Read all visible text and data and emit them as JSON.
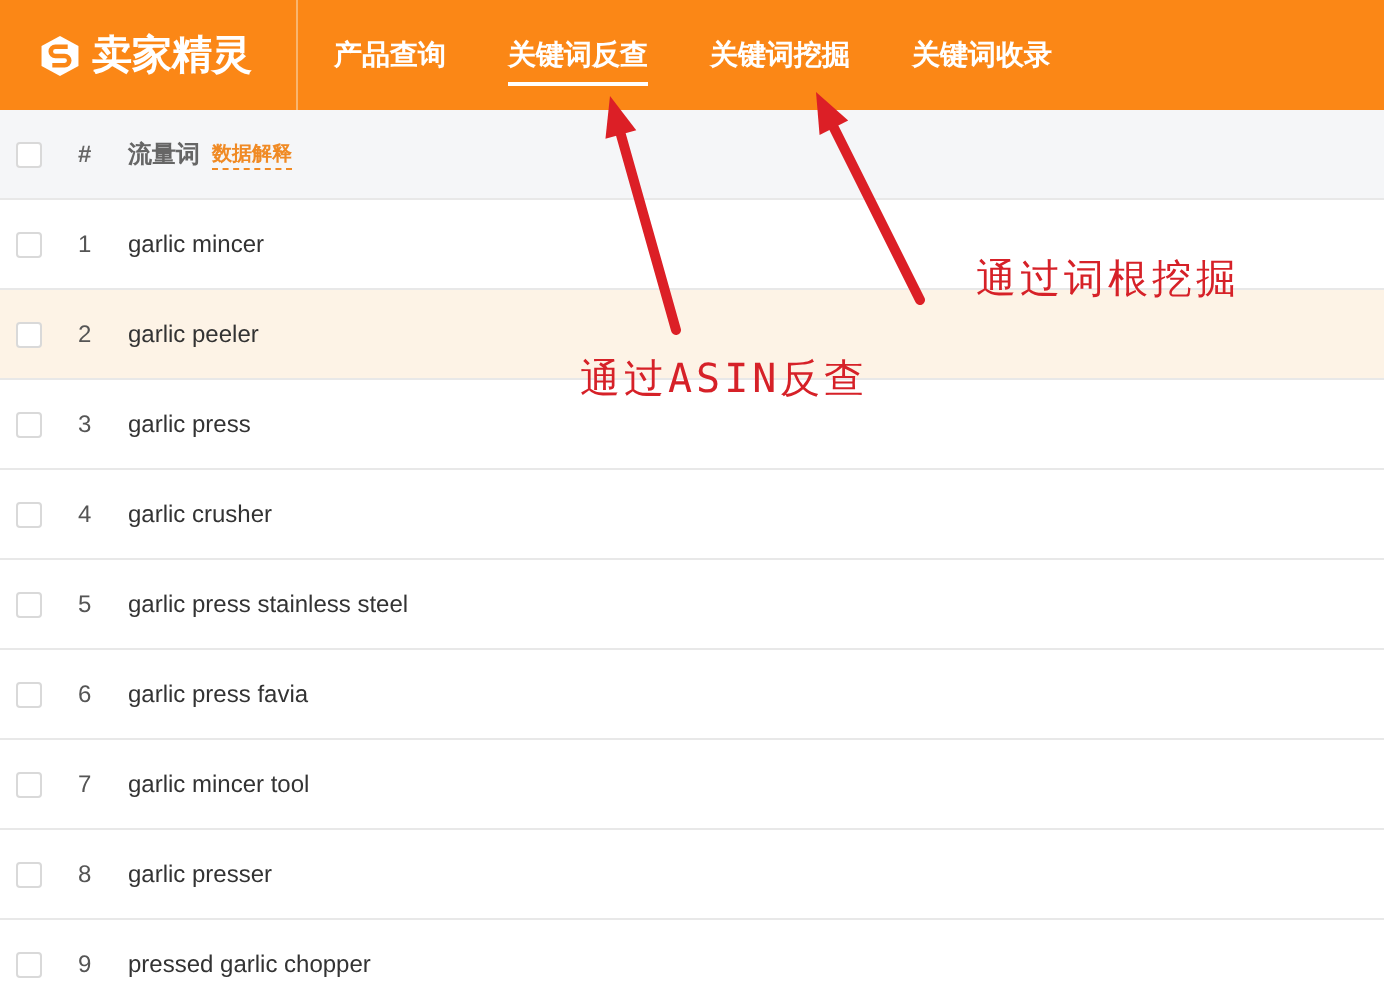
{
  "header": {
    "brand": "卖家精灵",
    "nav": [
      {
        "label": "产品查询",
        "selected": false
      },
      {
        "label": "关键词反查",
        "selected": true
      },
      {
        "label": "关键词挖掘",
        "selected": false
      },
      {
        "label": "关键词收录",
        "selected": false
      }
    ]
  },
  "table": {
    "select_all": {
      "checked": false
    },
    "columns": [
      "#",
      "流量词"
    ],
    "column_link": "数据解释",
    "rows": [
      {
        "index": "1",
        "keyword": "garlic mincer",
        "checked": false,
        "highlighted": false
      },
      {
        "index": "2",
        "keyword": "garlic peeler",
        "checked": false,
        "highlighted": true
      },
      {
        "index": "3",
        "keyword": "garlic press",
        "checked": false,
        "highlighted": false
      },
      {
        "index": "4",
        "keyword": "garlic crusher",
        "checked": false,
        "highlighted": false
      },
      {
        "index": "5",
        "keyword": "garlic press stainless steel",
        "checked": false,
        "highlighted": false
      },
      {
        "index": "6",
        "keyword": "garlic press favia",
        "checked": false,
        "highlighted": false
      },
      {
        "index": "7",
        "keyword": "garlic mincer tool",
        "checked": false,
        "highlighted": false
      },
      {
        "index": "8",
        "keyword": "garlic presser",
        "checked": false,
        "highlighted": false
      },
      {
        "index": "9",
        "keyword": "pressed garlic chopper",
        "checked": false,
        "highlighted": false
      }
    ]
  },
  "annotations": [
    {
      "text": "通过ASIN反查"
    },
    {
      "text": "通过词根挖掘"
    }
  ]
}
